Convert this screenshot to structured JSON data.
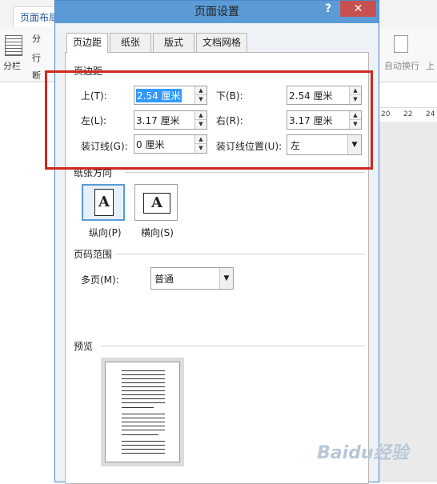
{
  "background_app": {
    "tab": "页面布局",
    "left_button": "分栏",
    "left_small_icons": [
      "分",
      "行",
      "断"
    ],
    "right_button": "自动换行",
    "right_truncated": "上",
    "ruler_numbers": [
      "20",
      "22",
      "24"
    ]
  },
  "dialog": {
    "title": "页面设置",
    "help": "?",
    "close": "✕",
    "tabs": [
      "页边距",
      "纸张",
      "版式",
      "文档网格"
    ],
    "margins": {
      "section": "页边距",
      "top_label": "上(T):",
      "top_value": "2.54 厘米",
      "bottom_label": "下(B):",
      "bottom_value": "2.54 厘米",
      "left_label": "左(L):",
      "left_value": "3.17 厘米",
      "right_label": "右(R):",
      "right_value": "3.17 厘米",
      "gutter_label": "装订线(G):",
      "gutter_value": "0 厘米",
      "gutter_pos_label": "装订线位置(U):",
      "gutter_pos_value": "左"
    },
    "orientation": {
      "section": "纸张方向",
      "portrait": "纵向(P)",
      "landscape": "横向(S)",
      "glyph": "A",
      "selected": "portrait"
    },
    "pages": {
      "section": "页码范围",
      "multiple_label": "多页(M):",
      "multiple_value": "普通"
    },
    "preview": {
      "section": "预览"
    }
  },
  "watermark": "Baidu经验",
  "colors": {
    "accent": "#5b9bd5",
    "highlight_box": "#d0281e",
    "close": "#c75050"
  }
}
